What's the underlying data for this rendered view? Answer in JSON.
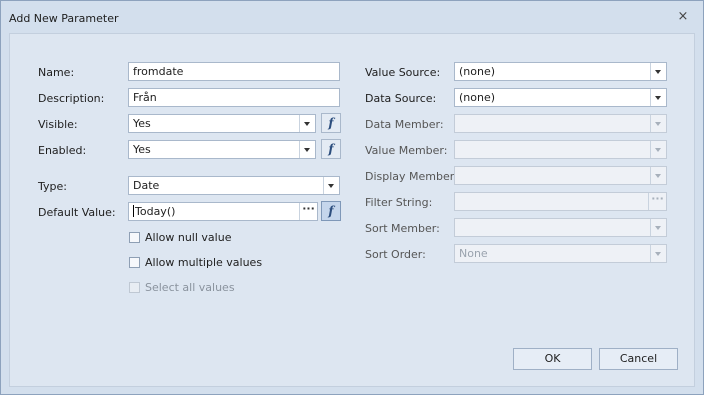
{
  "window": {
    "title": "Add New Parameter",
    "close_glyph": "×"
  },
  "left": {
    "name": {
      "label": "Name:",
      "value": "fromdate"
    },
    "description": {
      "label": "Description:",
      "value": "Från"
    },
    "visible": {
      "label": "Visible:",
      "value": "Yes"
    },
    "enabled": {
      "label": "Enabled:",
      "value": "Yes"
    },
    "type": {
      "label": "Type:",
      "value": "Date"
    },
    "default_value": {
      "label": "Default Value:",
      "value": "Today()"
    },
    "expression_button_glyph": "f",
    "ellipsis_glyph": "···",
    "checkboxes": [
      {
        "label": "Allow null value",
        "checked": false,
        "enabled": true
      },
      {
        "label": "Allow multiple values",
        "checked": false,
        "enabled": true
      },
      {
        "label": "Select all values",
        "checked": false,
        "enabled": false
      }
    ]
  },
  "right": {
    "value_source": {
      "label": "Value Source:",
      "value": "(none)"
    },
    "data_source": {
      "label": "Data Source:",
      "value": "(none)"
    },
    "data_member": {
      "label": "Data Member:",
      "value": ""
    },
    "value_member": {
      "label": "Value Member:",
      "value": ""
    },
    "display_member": {
      "label": "Display Member:",
      "value": ""
    },
    "filter_string": {
      "label": "Filter String:",
      "value": ""
    },
    "sort_member": {
      "label": "Sort Member:",
      "value": ""
    },
    "sort_order": {
      "label": "Sort Order:",
      "value": "None"
    }
  },
  "buttons": {
    "ok": "OK",
    "cancel": "Cancel"
  },
  "colors": {
    "window_bg": "#d3dfed",
    "panel_bg": "#dde6f1",
    "border": "#8da2bd"
  }
}
